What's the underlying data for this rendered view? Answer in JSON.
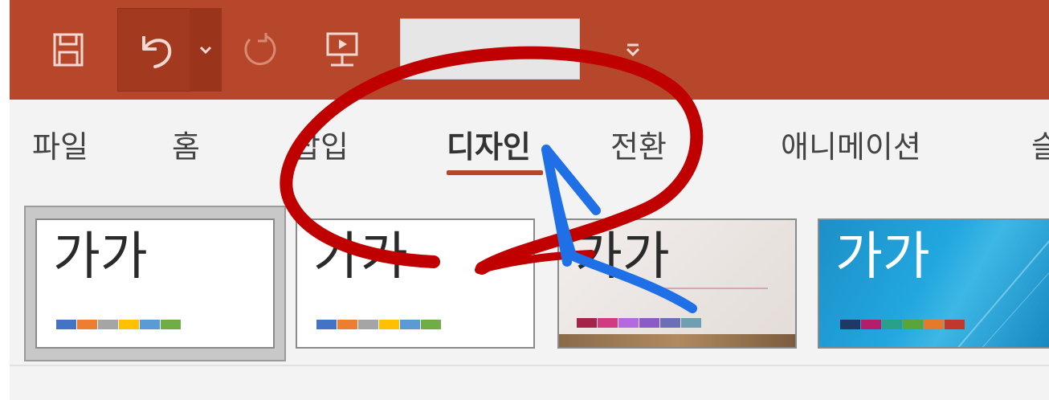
{
  "quick_access": {
    "icons": [
      "save-icon",
      "undo-icon",
      "chevron-down-icon",
      "redo-icon",
      "start-from-beginning-icon",
      "customize-toolbar-icon"
    ],
    "input_value": ""
  },
  "tabs": [
    {
      "label": "파일"
    },
    {
      "label": "홈"
    },
    {
      "label": "삽입"
    },
    {
      "label": "디자인",
      "active": true
    },
    {
      "label": "전환"
    },
    {
      "label": "애니메이션"
    },
    {
      "label": "슬"
    }
  ],
  "themes": [
    {
      "sample": "가가",
      "swatches": [
        "#4472c4",
        "#ed7d31",
        "#a5a5a5",
        "#ffc000",
        "#5b9bd5",
        "#70ad47"
      ],
      "selected": true
    },
    {
      "sample": "가가",
      "swatches": [
        "#4472c4",
        "#ed7d31",
        "#a5a5a5",
        "#ffc000",
        "#5b9bd5",
        "#70ad47"
      ]
    },
    {
      "sample": "가가",
      "swatches": [
        "#a5234a",
        "#d23b82",
        "#b36adf",
        "#8a5bc6",
        "#6a6fb6",
        "#6f9fb0"
      ]
    },
    {
      "sample": "가가",
      "swatches": [
        "#1f3864",
        "#b41d6c",
        "#29a08a",
        "#5aa53a",
        "#e67a2a",
        "#c2362b"
      ]
    }
  ],
  "colors": {
    "title_bar": "#b7472a",
    "active_tab_underline": "#b7472a",
    "annotation_circle": "#c00000",
    "annotation_arrow": "#1f6fe6"
  }
}
